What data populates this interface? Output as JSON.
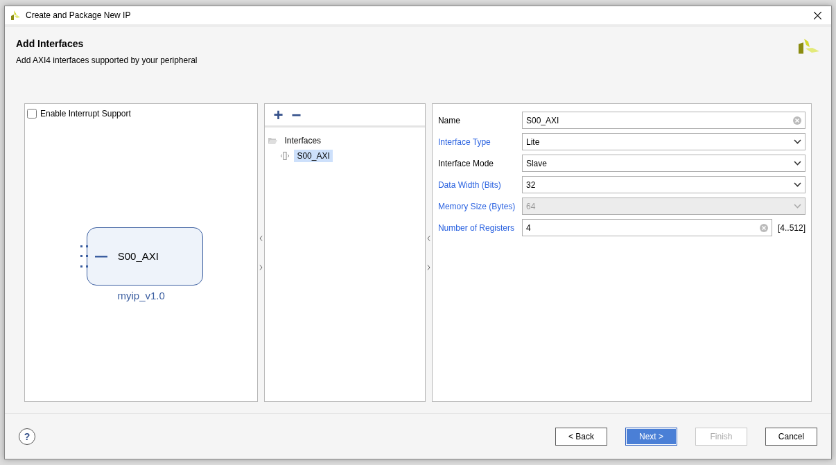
{
  "window": {
    "title": "Create and Package New IP"
  },
  "header": {
    "title": "Add Interfaces",
    "subtitle": "Add AXI4 interfaces supported by your peripheral"
  },
  "diagram": {
    "interrupt": {
      "label": "Enable Interrupt Support",
      "checked": false
    },
    "block": {
      "port": "S00_AXI",
      "name": "myip_v1.0"
    }
  },
  "interfaces": {
    "add": "+",
    "remove": "−",
    "tree": [
      {
        "label": "Interfaces",
        "expanded": true,
        "children": [
          {
            "label": "S00_AXI",
            "selected": true
          }
        ]
      }
    ]
  },
  "properties": [
    {
      "label": "Name",
      "highlighted": false,
      "kind": "text",
      "value": "S00_AXI",
      "disabled": false
    },
    {
      "label": "Interface Type",
      "highlighted": true,
      "kind": "select",
      "value": "Lite",
      "disabled": false
    },
    {
      "label": "Interface Mode",
      "highlighted": false,
      "kind": "select",
      "value": "Slave",
      "disabled": false
    },
    {
      "label": "Data Width (Bits)",
      "highlighted": true,
      "kind": "select",
      "value": "32",
      "disabled": false
    },
    {
      "label": "Memory Size (Bytes)",
      "highlighted": true,
      "kind": "select",
      "value": "64",
      "disabled": true
    },
    {
      "label": "Number of Registers",
      "highlighted": true,
      "kind": "text",
      "value": "4",
      "disabled": false,
      "range": "[4..512]"
    }
  ],
  "footer": {
    "help": "?",
    "buttons": [
      {
        "label": "< Back",
        "primary": false,
        "disabled": false
      },
      {
        "label": "Next >",
        "primary": true,
        "disabled": false
      },
      {
        "label": "Finish",
        "primary": false,
        "disabled": true
      },
      {
        "label": "Cancel",
        "primary": false,
        "disabled": false
      }
    ]
  }
}
